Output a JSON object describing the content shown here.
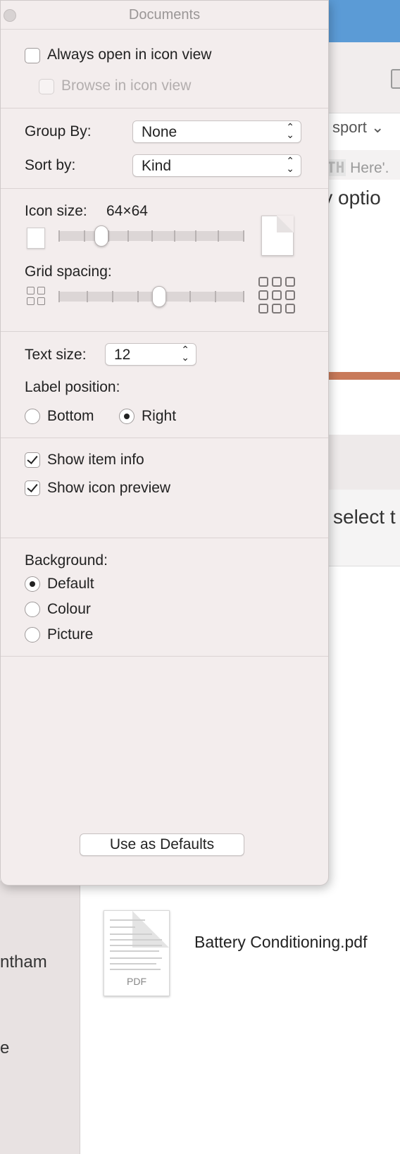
{
  "inspector": {
    "title": "Documents",
    "always_open_icon_view": {
      "label": "Always open in icon view",
      "checked": false
    },
    "browse_icon_view": {
      "label": "Browse in icon view",
      "checked": false,
      "enabled": false
    },
    "group_by": {
      "label": "Group By:",
      "value": "None"
    },
    "sort_by": {
      "label": "Sort by:",
      "value": "Kind"
    },
    "icon_size": {
      "label": "Icon size:",
      "value_text": "64×64",
      "slider_fraction": 0.23
    },
    "grid_spacing": {
      "label": "Grid spacing:",
      "slider_fraction": 0.54
    },
    "text_size": {
      "label": "Text size:",
      "value": "12"
    },
    "label_position": {
      "label": "Label position:",
      "options": [
        "Bottom",
        "Right"
      ],
      "selected": "Right"
    },
    "show_item_info": {
      "label": "Show item info",
      "checked": true
    },
    "show_icon_preview": {
      "label": "Show icon preview",
      "checked": true
    },
    "background": {
      "label": "Background:",
      "options": [
        "Default",
        "Colour",
        "Picture"
      ],
      "selected": "Default"
    },
    "use_as_defaults": "Use as Defaults"
  },
  "background_window": {
    "toolbar_item": "sport",
    "search_text_prefix": "TH",
    "search_text": "Here'.",
    "partial_text_1": "ly optio",
    "partial_text_2": "select t",
    "sidebar_items": [
      "ntham",
      "e"
    ],
    "file": {
      "name": "Battery Conditioning.pdf",
      "thumb_label": "PDF"
    }
  },
  "colors": {
    "titlebar_blue": "#5b9bd6",
    "panel_bg": "#f3eded",
    "accent_orange": "#c87a5a"
  }
}
